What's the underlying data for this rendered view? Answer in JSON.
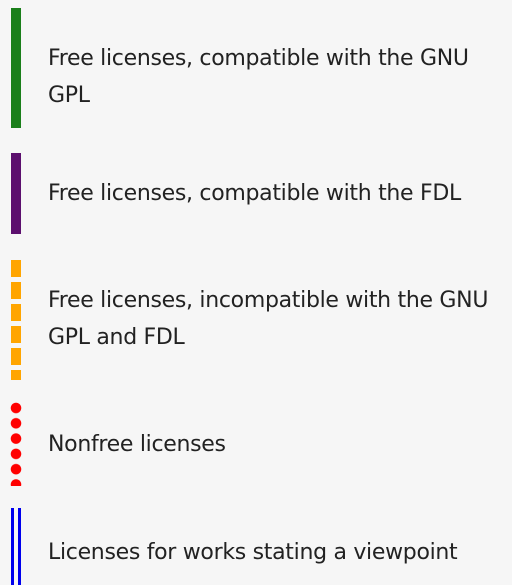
{
  "legend": {
    "items": [
      {
        "label": "Free licenses, compatible with the GNU GPL",
        "line_style": "solid",
        "color": "#1a7f1a"
      },
      {
        "label": "Free licenses, compatible with the FDL",
        "line_style": "solid",
        "color": "#5c0f6e"
      },
      {
        "label": "Free licenses, incompatible with the GNU GPL and FDL",
        "line_style": "dashed",
        "color": "#ffa500"
      },
      {
        "label": "Nonfree licenses",
        "line_style": "dotted",
        "color": "#ff0000"
      },
      {
        "label": "Licenses for works stating a viewpoint",
        "line_style": "double",
        "color": "#0000ee"
      }
    ]
  }
}
